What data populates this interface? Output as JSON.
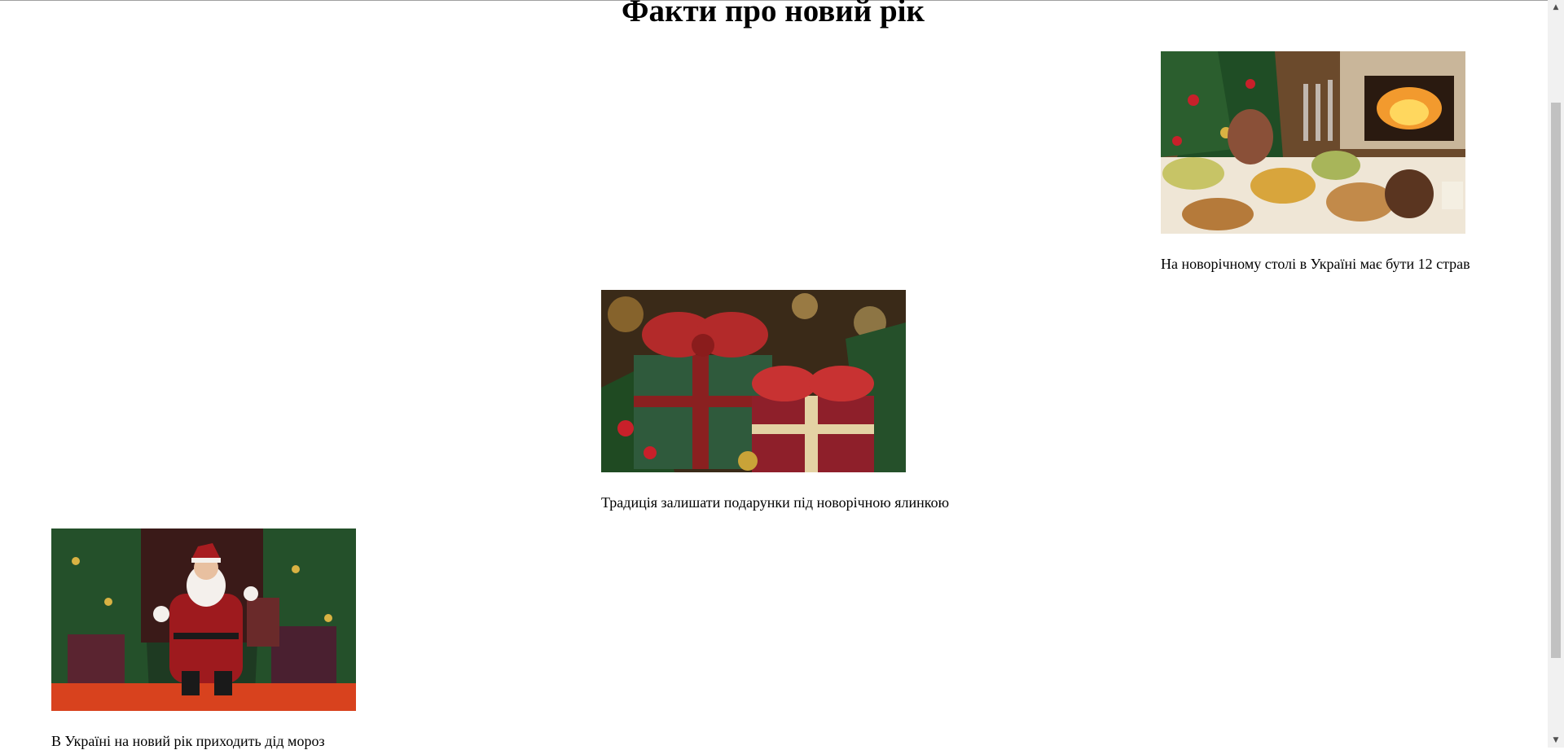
{
  "page": {
    "title": "Факти про новий рік"
  },
  "facts": [
    {
      "caption": "На новорічному столі в Україні має бути 12 страв",
      "image": "festive-table-photo"
    },
    {
      "caption": "Традиція залишати подарунки під новорічною ялинкою",
      "image": "gift-boxes-photo"
    },
    {
      "caption": "В Україні на новий рік приходить дід мороз",
      "image": "santa-claus-photo"
    }
  ],
  "scrollbar": {
    "up_icon": "▲",
    "down_icon": "▼"
  }
}
